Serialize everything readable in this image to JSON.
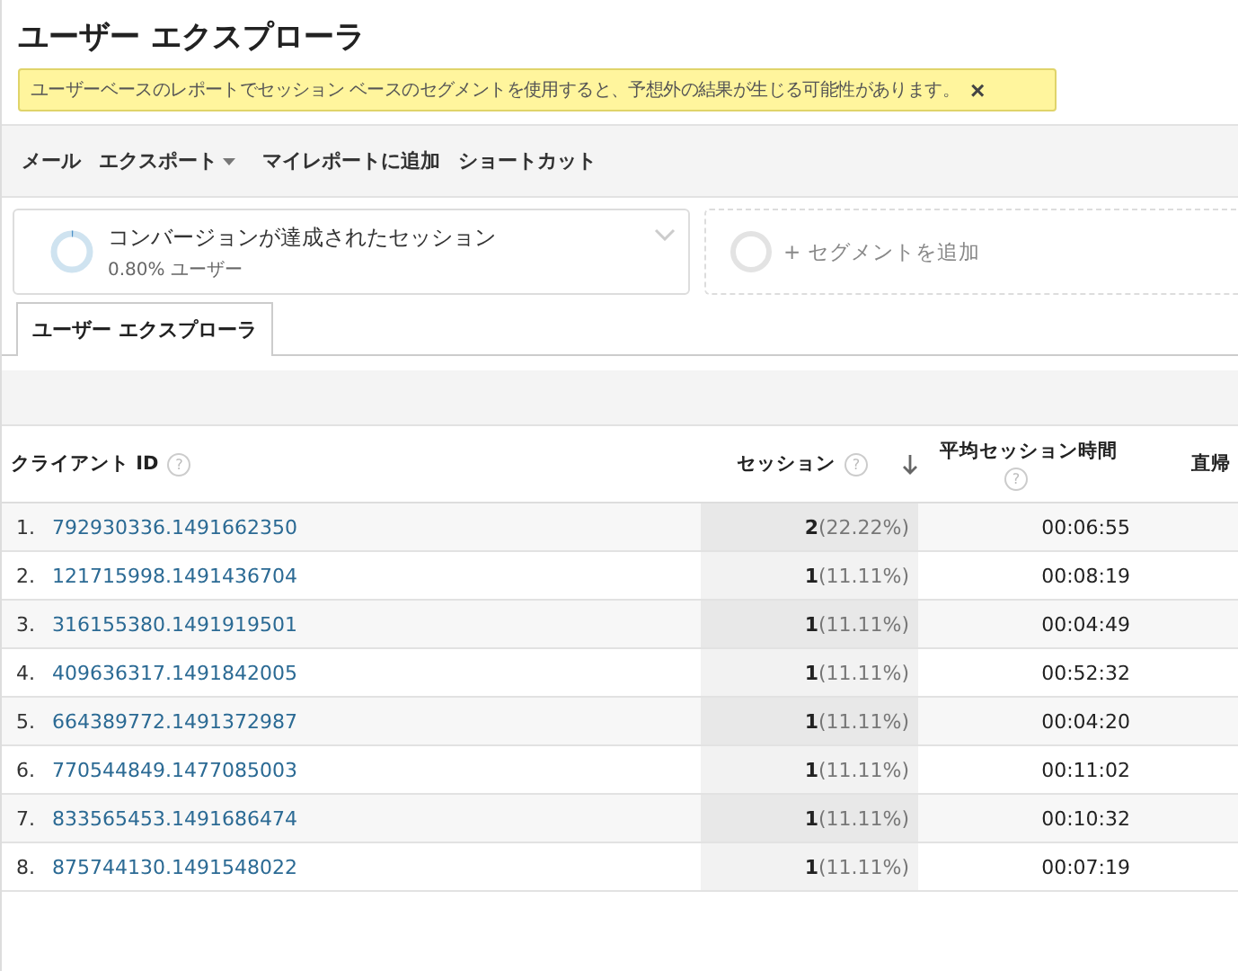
{
  "title": "ユーザー エクスプローラ",
  "notice": {
    "text": "ユーザーベースのレポートでセッション ベースのセグメントを使用すると、予想外の結果が生じる可能性があります。",
    "close": "×"
  },
  "toolbar": [
    {
      "label": "メール",
      "dropdown": false
    },
    {
      "label": "エクスポート",
      "dropdown": true
    },
    {
      "label": "マイレポートに追加",
      "dropdown": false
    },
    {
      "label": "ショートカット",
      "dropdown": false
    }
  ],
  "segments": [
    {
      "kind": "segment",
      "name": "コンバージョンが達成されたセッション",
      "detail": "0.80% ユーザー"
    },
    {
      "kind": "add",
      "name": "+ セグメントを追加"
    }
  ],
  "tabs": [
    {
      "label": "ユーザー エクスプローラ",
      "selected": true
    }
  ],
  "table": {
    "columns": [
      {
        "label": "クライアント ID",
        "help": "?"
      },
      {
        "label": "セッション",
        "help": "?",
        "sorted": true
      },
      {
        "label": "平均セッション時間",
        "help": "?"
      },
      {
        "label": "直帰"
      }
    ],
    "rows": [
      {
        "index": "1.",
        "client_id": "792930336.1491662350",
        "sessions": "2",
        "share": "(22.22%)",
        "duration": "00:06:55"
      },
      {
        "index": "2.",
        "client_id": "121715998.1491436704",
        "sessions": "1",
        "share": "(11.11%)",
        "duration": "00:08:19"
      },
      {
        "index": "3.",
        "client_id": "316155380.1491919501",
        "sessions": "1",
        "share": "(11.11%)",
        "duration": "00:04:49"
      },
      {
        "index": "4.",
        "client_id": "409636317.1491842005",
        "sessions": "1",
        "share": "(11.11%)",
        "duration": "00:52:32"
      },
      {
        "index": "5.",
        "client_id": "664389772.1491372987",
        "sessions": "1",
        "share": "(11.11%)",
        "duration": "00:04:20"
      },
      {
        "index": "6.",
        "client_id": "770544849.1477085003",
        "sessions": "1",
        "share": "(11.11%)",
        "duration": "00:11:02"
      },
      {
        "index": "7.",
        "client_id": "833565453.1491686474",
        "sessions": "1",
        "share": "(11.11%)",
        "duration": "00:10:32"
      },
      {
        "index": "8.",
        "client_id": "875744130.1491548022",
        "sessions": "1",
        "share": "(11.11%)",
        "duration": "00:07:19"
      }
    ]
  }
}
